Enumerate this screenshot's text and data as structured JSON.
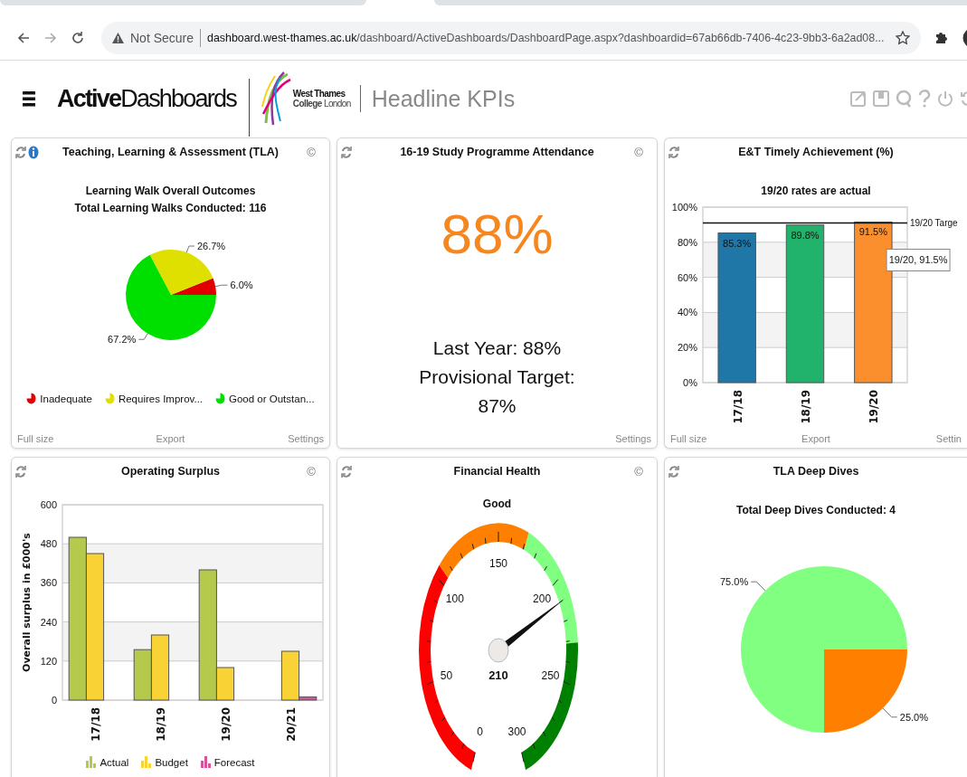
{
  "address_bar": {
    "security_label": "Not Secure",
    "url_host": "dashboard.west-thames.ac.uk",
    "url_rest": "/dashboard/ActiveDashboards/DashboardPage.aspx?dashboardid=67ab66db-7406-4c23-9bb3-6a2ad08..."
  },
  "header": {
    "logo": "**Active**Dashboards",
    "college_line1": "West Thames",
    "college_line2": "**College** London",
    "page_title": "Headline KPIs"
  },
  "panels": [
    {
      "kind": "pie",
      "title": "Teaching, Learning & Assessment (TLA)",
      "info": true,
      "copyright": "©",
      "subtitles": [
        "Learning Walk Overall Outcomes",
        "Total Learning Walks Conducted: 116"
      ],
      "chart_data": {
        "type": "pie",
        "categories": [
          "Inadequate",
          "Requires Improv...",
          "Good or Outstan..."
        ],
        "values": [
          6.0,
          26.7,
          67.2
        ],
        "colors": [
          "#e00000",
          "#e0e000",
          "#00e000"
        ],
        "value_labels": [
          "6.0%",
          "26.7%",
          "67.2%"
        ]
      },
      "footer": {
        "left": "Full size",
        "center": "Export",
        "right": "Settings"
      }
    },
    {
      "kind": "figure",
      "title": "16-19 Study Programme Attendance",
      "copyright": "©",
      "value": "88%",
      "lines": [
        "Last Year: 88%",
        "Provisional Target:",
        "87%"
      ],
      "footer": {
        "right": "Settings"
      }
    },
    {
      "kind": "bar",
      "title": "E&T Timely Achievement (%)",
      "subtitles": [
        "19/20 rates are actual"
      ],
      "tooltip": "19/20, 91.5%",
      "chart_data": {
        "type": "bar",
        "stacked": true,
        "grid": true,
        "categories": [
          "17/18",
          "18/19",
          "19/20"
        ],
        "series": [
          {
            "color": "#1f77a8",
            "values": [
              85.3,
              null,
              null
            ]
          },
          {
            "color": "#21b36b",
            "values": [
              null,
              89.8,
              null
            ]
          },
          {
            "color": "#fb8f2e",
            "values": [
              null,
              null,
              91.5
            ]
          }
        ],
        "ylim": [
          0,
          100
        ],
        "yticks": [
          {
            "value": 0,
            "label": "0%"
          },
          {
            "value": 20,
            "label": "20%"
          },
          {
            "value": 40,
            "label": "40%"
          },
          {
            "value": 60,
            "label": "60%"
          },
          {
            "value": 80,
            "label": "80%"
          },
          {
            "value": 100,
            "label": "100%"
          }
        ],
        "value_labels": [
          "85.3%",
          "89.8%",
          "91.5%"
        ],
        "ref_lines": [
          {
            "axis": "y",
            "value": 91,
            "label": "19/20 Targe"
          }
        ]
      },
      "footer": {
        "left": "Full size",
        "center": "Export",
        "right": "Settin"
      }
    },
    {
      "kind": "bar",
      "title": "Operating Surplus",
      "copyright": "©",
      "chart_data": {
        "type": "bar",
        "stacked": false,
        "grid": true,
        "ylabel": "Overall surplus in £000's",
        "categories": [
          "17/18",
          "18/19",
          "19/20",
          "20/21"
        ],
        "series": [
          {
            "name": "Actual",
            "color": "#b5c94d",
            "values": [
              500,
              155,
              400,
              null
            ]
          },
          {
            "name": "Budget",
            "color": "#f9d236",
            "values": [
              450,
              200,
              100,
              150
            ]
          },
          {
            "name": "Forecast",
            "color": "#d6559a",
            "values": [
              null,
              null,
              null,
              10
            ]
          }
        ],
        "ylim": [
          0,
          600
        ],
        "yticks": [
          0,
          120,
          240,
          360,
          480,
          600
        ]
      }
    },
    {
      "kind": "gauge",
      "title": "Financial Health",
      "copyright": "©",
      "subtitles": [
        "Good"
      ],
      "gauge": {
        "reading": "210",
        "scale": [
          "0",
          "50",
          "100",
          "150",
          "200",
          "250",
          "300"
        ],
        "bands": [
          {
            "color": "#ff0000"
          },
          {
            "color": "#ff8000"
          },
          {
            "color": "#80ff80"
          },
          {
            "color": "#008000"
          }
        ]
      }
    },
    {
      "kind": "pie",
      "title": "TLA Deep Dives",
      "subtitles": [
        "Total Deep Dives Conducted: 4"
      ],
      "chart_data": {
        "type": "pie",
        "values": [
          75.0,
          25.0
        ],
        "colors": [
          "#80ff80",
          "#ff8000"
        ],
        "value_labels": [
          "75.0%",
          "25.0%"
        ]
      }
    }
  ]
}
